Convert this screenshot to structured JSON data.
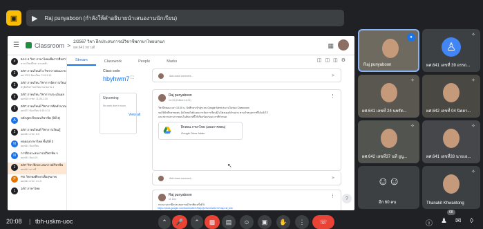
{
  "topbar": {
    "presenter_label": "Raj punyaboon (กำลังให้คำอธิบายนำเสนองานนักเรียน)",
    "present_icon": "present-screen-icon"
  },
  "classroom": {
    "app_title": "Classroom",
    "class_name": "2/2567 วิชา ฝึกประสบการณ์วิชาชีพภาษาไทยบกนก",
    "class_sub": "ผศ.641 ทร.บดี",
    "tabs": [
      "Stream",
      "Classwork",
      "People",
      "Marks"
    ],
    "sidebar": [
      {
        "icon": "#",
        "t1": "64-1-1 วิชา ภาษาไทยเพื่อการสื่อสาร",
        "t2": "สาขาวิชาศึกษา ตามหลัก",
        "hl": false
      },
      {
        "icon": "2",
        "t1": "2/67 ภาคเรียนที่ 1 วิชาการสอนภาษาไทย",
        "t2": "ผศ.7/2/1 ห้องเรียน 7:15 9:15",
        "hl": false
      },
      {
        "icon": "2",
        "t1": "2/67 ภาคเรียน วิชาการจัดการเรียนรู้",
        "t2": "ครูจัดกิจกรรมเรียน หน่วยงาน 1",
        "hl": false
      },
      {
        "icon": "2",
        "t1": "2/67 ภาคเรียน วิชาการประเมินผล",
        "t2": "ผศ.610 สาขา 11:30-1:30",
        "hl": false
      },
      {
        "icon": "2",
        "t1": "2/67 ภาคเรียนที่ วิชาการคิดคำนวณ",
        "t2": "ผศ.627 ห้องเรียน 9:15 4:11",
        "hl": false
      },
      {
        "icon": "A",
        "t1": "หลักสูตร ฝึกสอนวิชาชีพ (ปีที่ 3)",
        "t2": "",
        "hl": false
      },
      {
        "icon": "2",
        "t1": "2/67 ภาคเรียนที่ วิชาการเรียนรู้",
        "t2": "ผศ.641 สาขา 6:5",
        "hl": false
      },
      {
        "icon": "N",
        "t1": "ทดลองภาษาไทย ชั้นปีที่ 3",
        "t2": "ผศ.641 ห้องเรียน",
        "hl": false
      },
      {
        "icon": "N",
        "t1": "การฝึกประสบการณ์วิชาชีพ ฯ",
        "t2": "ผศ.641 ห้อง 4/1",
        "hl": false
      },
      {
        "icon": "2",
        "t1": "2/67 วิชา ฝึกประสบการณ์วิชาชีพ",
        "t2": "ผศ.641 ทร.บดี",
        "hl": true
      },
      {
        "icon": "P",
        "t1": "P.E วิชาพลศึกษาเพื่อสุขภาพ",
        "t2": "ผศ.641 สาขา 4:1.5",
        "hl": false
      },
      {
        "icon": "1",
        "t1": "1/67 ภาษาไทย",
        "t2": "",
        "hl": false
      }
    ],
    "class_code_label": "Class code",
    "class_code": "hbyhwm7",
    "upcoming_title": "Upcoming",
    "upcoming_none": "No work due in soon",
    "upcoming_view_all": "View all",
    "comment_placeholder": "Add class comment...",
    "post1": {
      "author": "Raj punyaboon",
      "date": "14:15 (Edited 14:21)",
      "body1": "วิชาฝึกสอนเวลา 13.00 น. นักศึกษาเข้าสู่ระบบ Google Meet ส่งงานในช่อง Classroom",
      "body2": "ขอให้นักศึกษาทุกคน อัปโหลดไฟล์แผนการจัดการเรียนรู้ในโฟลเดอร์ด้านล่าง ตามกำหนดการที่ได้แจ้งไว้",
      "body3": "และส่งรายงานการสอนในสัปดาห์นี้ให้เรียบร้อยก่อนเวลาที่กำหนด",
      "attachment_title": "ฝึกสอน ภาษาไทย (แผนการสอน)",
      "attachment_sub": "Google Drive folder"
    },
    "post2": {
      "author": "Raj punyaboon",
      "date": "11 Dec",
      "body1": "กระบวนการฝึกประสบการณ์วิชาชีพ ครั้งที่ 5",
      "link": "https://docs.google.com/forms/d/e/1FAIpQLSc/viewform?usp=sf_link"
    }
  },
  "participants": [
    {
      "name": "Raj punyaboon",
      "type": "video",
      "pinned": false
    },
    {
      "name": "ผศ.641 เลขที่ 39 อรรถ...",
      "type": "avatar",
      "pinned": true
    },
    {
      "name": "ผศ.641 เลขที่ 24 นพรัต...",
      "type": "video",
      "pinned": true
    },
    {
      "name": "ผศ.642 เลขที่ 04 นิตยา...",
      "type": "video",
      "pinned": true
    },
    {
      "name": "ผศ.642 เลขที่37 นที ยูนู...",
      "type": "video",
      "pinned": true
    },
    {
      "name": "ผศ.641 เลขที่33 นายเอ...",
      "type": "video",
      "pinned": true
    },
    {
      "name": "อีก 60 คน",
      "type": "group",
      "pinned": false
    },
    {
      "name": "Thanakit Khwantong",
      "type": "video",
      "pinned": true
    }
  ],
  "bottombar": {
    "time": "20:08",
    "meeting_code": "tbh-uskm-uoc",
    "participant_count": "68"
  },
  "colors": {
    "accent": "#1a73e8",
    "end_call": "#ea4335",
    "bg": "#202124",
    "tile": "#3c4043"
  }
}
